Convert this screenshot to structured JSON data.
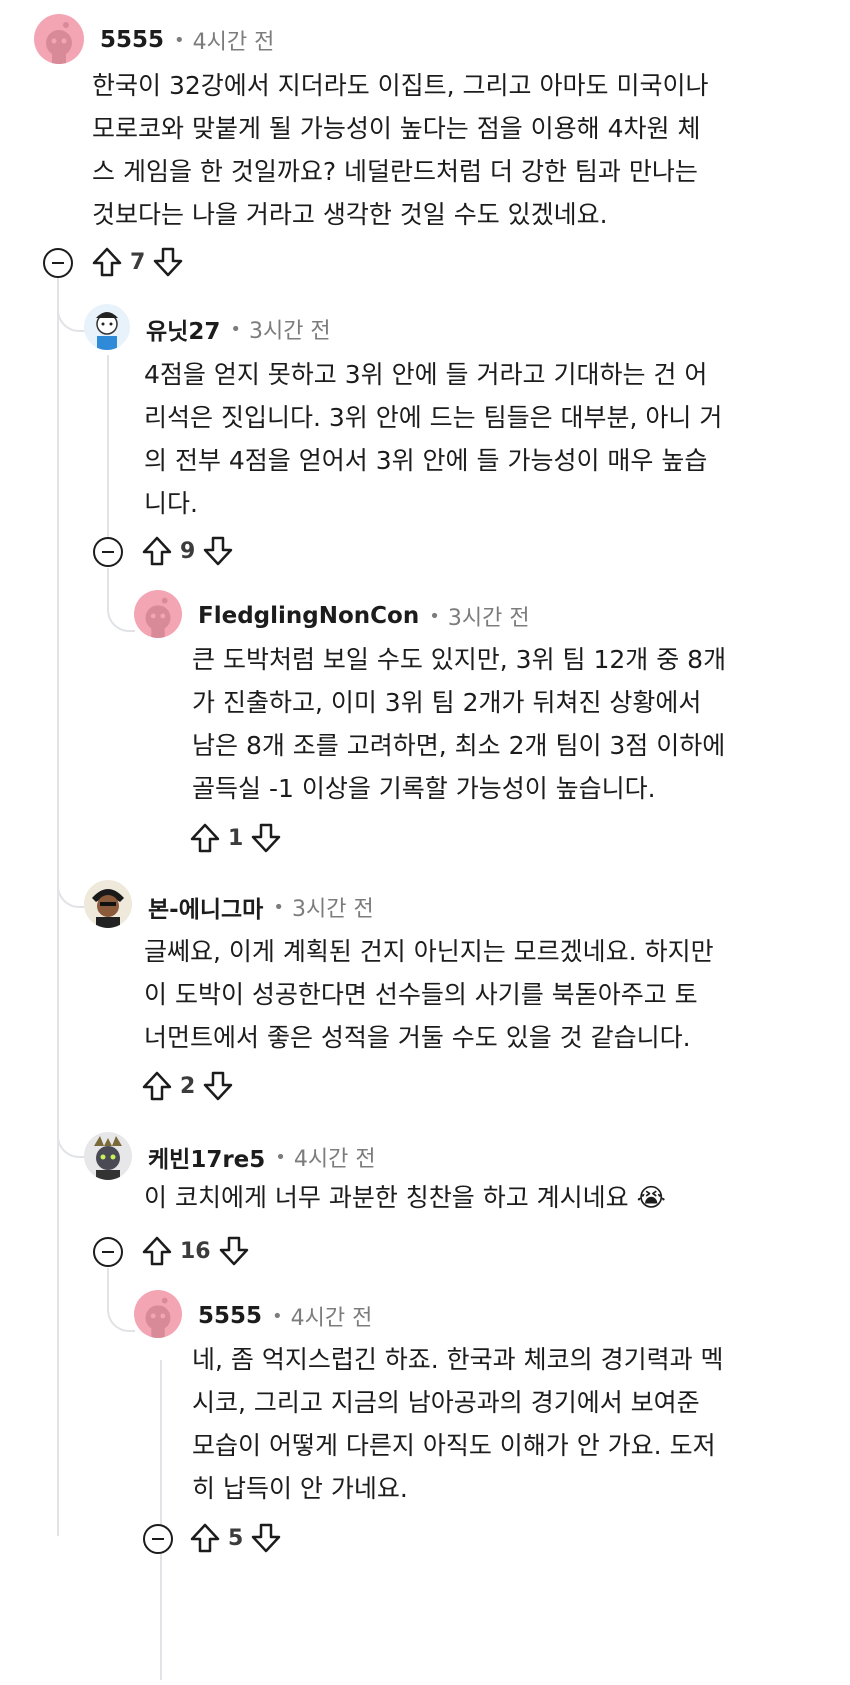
{
  "comments": [
    {
      "id": "c1",
      "user": "5555",
      "time": "4시간 전",
      "lines": [
        "한국이 32강에서 지더라도 이집트, 그리고 아마도 미국이나",
        "모로코와 맞붙게 될 가능성이 높다는 점을 이용해 4차원 체",
        "스 게임을 한 것일까요? 네덜란드처럼 더 강한 팀과 만나는",
        "것보다는 나을 거라고 생각한 것일 수도 있겠네요."
      ],
      "votes": "7"
    },
    {
      "id": "c2",
      "user": "유닛27",
      "time": "3시간 전",
      "lines": [
        "4점을 얻지 못하고 3위 안에 들 거라고 기대하는 건 어",
        "리석은 짓입니다. 3위 안에 드는 팀들은 대부분, 아니 거",
        "의 전부 4점을 얻어서 3위 안에 들 가능성이 매우 높습",
        "니다."
      ],
      "votes": "9"
    },
    {
      "id": "c3",
      "user": "FledglingNonCon",
      "time": "3시간 전",
      "lines": [
        "큰 도박처럼 보일 수도 있지만, 3위 팀 12개 중 8개",
        "가 진출하고, 이미 3위 팀 2개가 뒤쳐진 상황에서",
        "남은 8개 조를 고려하면, 최소 2개 팀이 3점 이하에",
        "골득실 -1 이상을 기록할 가능성이 높습니다."
      ],
      "votes": "1"
    },
    {
      "id": "c4",
      "user": "본-에니그마",
      "time": "3시간 전",
      "lines": [
        "글쎄요, 이게 계획된 건지 아닌지는 모르겠네요. 하지만",
        "이 도박이 성공한다면 선수들의 사기를 북돋아주고 토",
        "너먼트에서 좋은 성적을 거둘 수도 있을 것 같습니다."
      ],
      "votes": "2"
    },
    {
      "id": "c5",
      "user": "케빈17re5",
      "time": "4시간 전",
      "lines": [
        "이 코치에게 너무 과분한 칭찬을 하고 계시네요 😭"
      ],
      "votes": "16"
    },
    {
      "id": "c6",
      "user": "5555",
      "time": "4시간 전",
      "lines": [
        "네, 좀 억지스럽긴 하죠. 한국과 체코의 경기력과 멕",
        "시코, 그리고 지금의 남아공과의 경기에서 보여준",
        "모습이 어떻게 다른지 아직도 이해가 안 가요. 도저",
        "히 납득이 안 가네요."
      ],
      "votes": "5"
    }
  ],
  "separator": "•",
  "colors": {
    "avatar_pink": "#f3a5b4",
    "text": "#1c1c1c",
    "meta": "#7c7c7c",
    "thread": "#e1e3e6"
  }
}
